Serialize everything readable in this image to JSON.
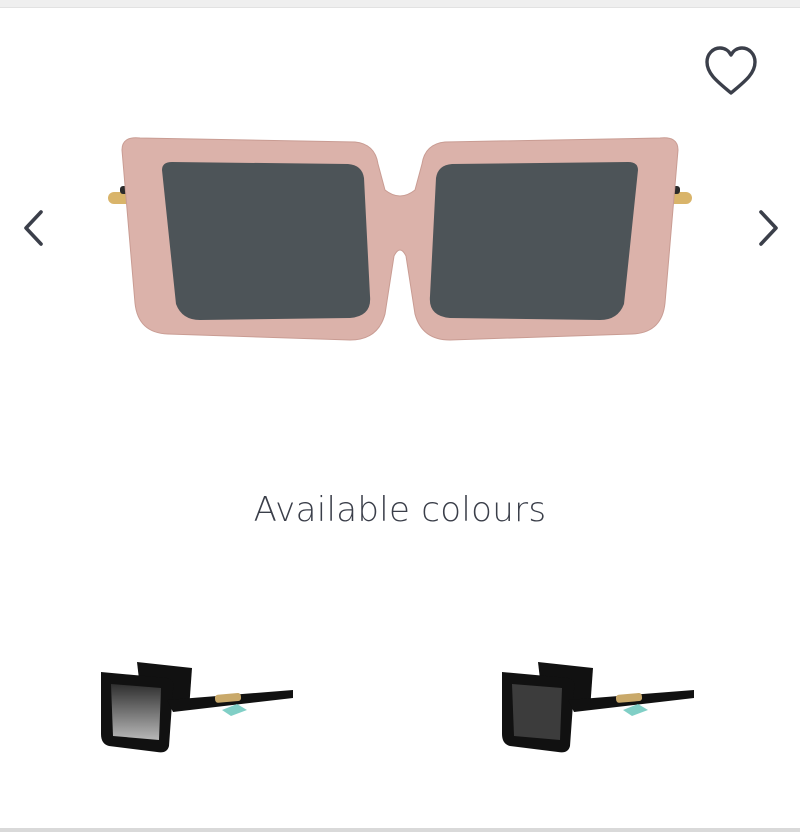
{
  "product": {
    "image_alt": "Pink square sunglasses with grey lenses and gold temples",
    "frame_color": "#dbb2aa",
    "lens_color": "#4d5458",
    "accent_color": "#80cfc6"
  },
  "icons": {
    "wishlist": "heart-icon",
    "prev": "chevron-left-icon",
    "next": "chevron-right-icon"
  },
  "available_colours": {
    "title": "Available colours",
    "items": [
      {
        "name": "black-gradient-grey",
        "frame_color": "#111111",
        "lens_color": "#5a5a5a"
      },
      {
        "name": "black-grey",
        "frame_color": "#111111",
        "lens_color": "#3c3c3c"
      }
    ]
  }
}
